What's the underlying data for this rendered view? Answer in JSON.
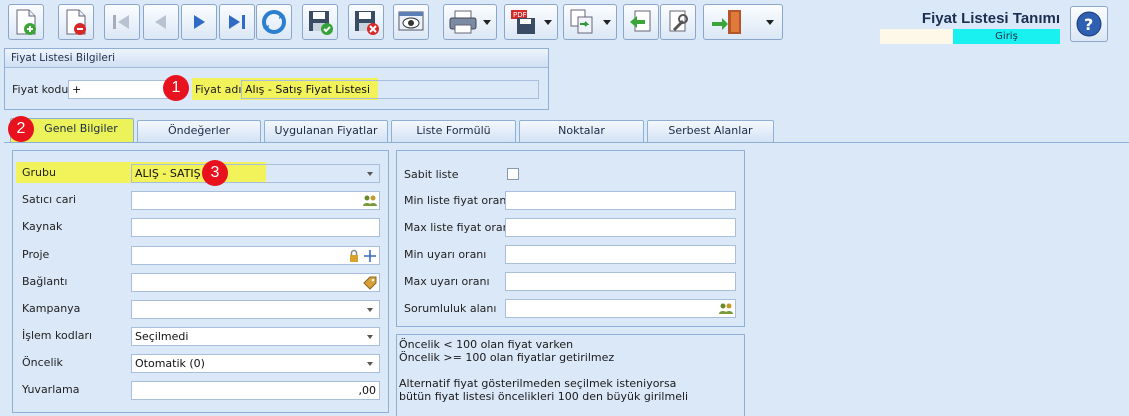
{
  "window": {
    "title": "Fiyat Listesi Tanımı",
    "mode": "Giriş"
  },
  "toolbar": [
    {
      "name": "new-record-button",
      "icon": "document-plus-icon"
    },
    {
      "name": "delete-record-button",
      "icon": "document-minus-icon"
    },
    {
      "name": "first-record-button",
      "icon": "first-icon"
    },
    {
      "name": "previous-record-button",
      "icon": "previous-icon"
    },
    {
      "name": "next-record-button",
      "icon": "next-icon"
    },
    {
      "name": "last-record-button",
      "icon": "last-icon"
    },
    {
      "name": "refresh-button",
      "icon": "refresh-icon"
    },
    {
      "name": "save-button",
      "icon": "save-check-icon"
    },
    {
      "name": "save-close-button",
      "icon": "save-cancel-icon"
    },
    {
      "name": "preview-button",
      "icon": "eye-icon"
    },
    {
      "name": "print-button",
      "icon": "printer-icon"
    },
    {
      "name": "export-pdf-button",
      "icon": "pdf-save-icon"
    },
    {
      "name": "copy-button",
      "icon": "copy-icon"
    },
    {
      "name": "back-button",
      "icon": "back-arrow-icon"
    },
    {
      "name": "tools-button",
      "icon": "wrench-icon"
    },
    {
      "name": "exit-button",
      "icon": "exit-door-icon"
    }
  ],
  "info_group": {
    "title": "Fiyat Listesi Bilgileri",
    "code_label": "Fiyat kodu",
    "code_value": "+",
    "name_label": "Fiyat adı",
    "name_value": "Alış - Satış Fiyat Listesi"
  },
  "markers": [
    "1",
    "2",
    "3"
  ],
  "tabs": [
    "Genel Bilgiler",
    "Öndeğerler",
    "Uygulanan Fiyatlar",
    "Liste Formülü",
    "Noktalar",
    "Serbest Alanlar"
  ],
  "left_panel": {
    "grubu_label": "Grubu",
    "grubu_value": "ALIŞ - SATIŞ",
    "satici_label": "Satıcı cari",
    "satici_value": "",
    "kaynak_label": "Kaynak",
    "kaynak_value": "",
    "proje_label": "Proje",
    "proje_value": "",
    "baglanti_label": "Bağlantı",
    "baglanti_value": "",
    "kampanya_label": "Kampanya",
    "kampanya_value": "",
    "islem_label": "İşlem kodları",
    "islem_value": "Seçilmedi",
    "oncelik_label": "Öncelik",
    "oncelik_value": "Otomatik (0)",
    "yuvarlama_label": "Yuvarlama",
    "yuvarlama_value": ",00"
  },
  "right_panel": {
    "sabit_label": "Sabit liste",
    "sabit_checked": false,
    "min_liste_label": "Min liste fiyat oranı",
    "max_liste_label": "Max liste fiyat oranı",
    "min_uyari_label": "Min uyarı oranı",
    "max_uyari_label": "Max uyarı oranı",
    "sorumluluk_label": "Sorumluluk alanı"
  },
  "notes": {
    "line1": "Öncelik < 100 olan fiyat varken",
    "line2": "Öncelik >= 100 olan fiyatlar getirilmez",
    "line3": "Alternatif fiyat gösterilmeden seçilmek isteniyorsa",
    "line4": "bütün fiyat listesi öncelikleri 100 den büyük girilmeli"
  },
  "colors": {
    "highlight": "#f2f25a",
    "marker": "#e8121f",
    "mode_badge": "#19f0f0",
    "background": "#dbe8f8"
  }
}
